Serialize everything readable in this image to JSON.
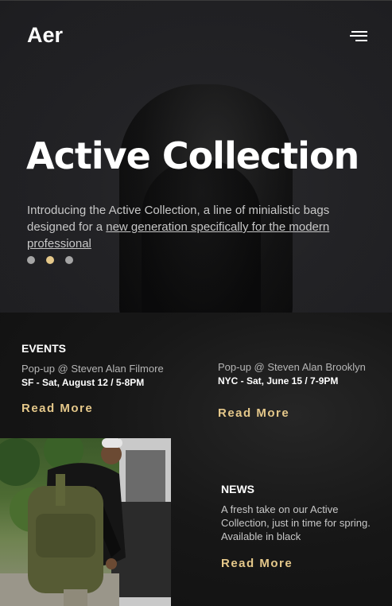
{
  "brand": {
    "logo": "Aer"
  },
  "header": {
    "menu_icon": "hamburger-menu-icon"
  },
  "hero": {
    "title": "Active Collection",
    "description_prefix": "Introducing the Active Collection, a line of minialistic bags designed for a ",
    "description_link": "new generation specifically for the modern professional",
    "slides": {
      "count": 3,
      "active_index": 1
    }
  },
  "events": {
    "title": "EVENTS",
    "items": [
      {
        "name": "Pop-up @ Steven Alan Filmore",
        "date": "SF - Sat, August 12 / 5-8PM",
        "cta": "Read More"
      },
      {
        "name": "Pop-up @ Steven Alan Brooklyn",
        "date": "NYC - Sat, June 15 / 7-9PM",
        "cta": "Read More"
      }
    ]
  },
  "news": {
    "title": "NEWS",
    "text": "A fresh take on our Active Collection, just in time for spring. Available in black",
    "cta": "Read More",
    "image_subject": "person-with-olive-backpack"
  },
  "colors": {
    "accent": "#e5c88a",
    "background": "#141414",
    "text_muted": "#c7c7c7"
  }
}
